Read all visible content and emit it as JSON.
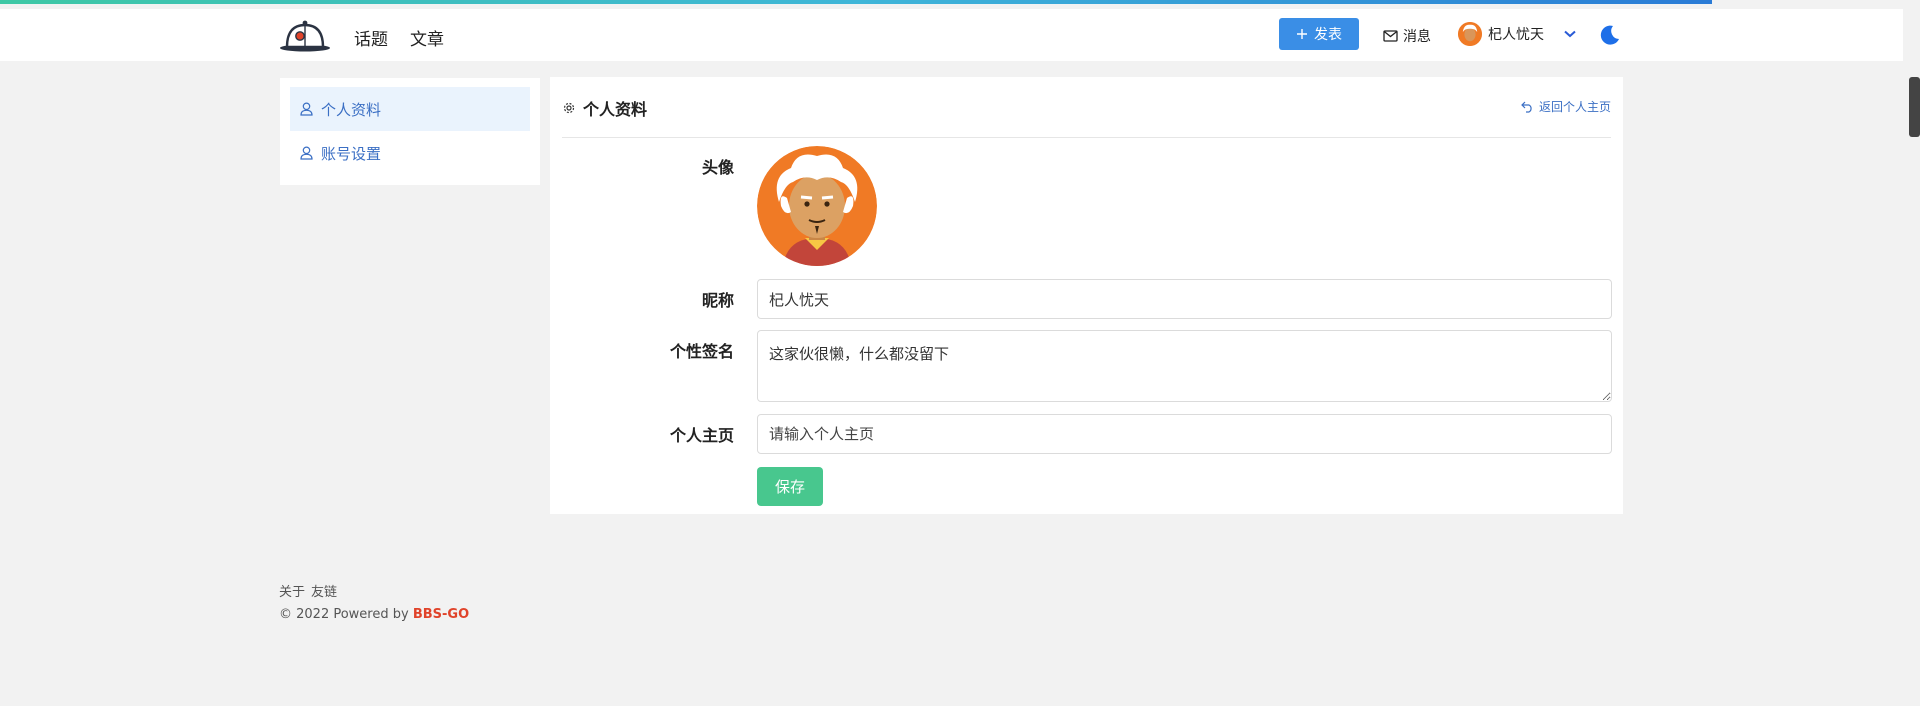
{
  "colors": {
    "accent": "#3a8ee6",
    "save": "#48c78e",
    "link": "#3b6fc4",
    "brand": "#e0432a",
    "avatar_bg": "#f07a25"
  },
  "header": {
    "nav": [
      {
        "label": "话题"
      },
      {
        "label": "文章"
      }
    ],
    "post_label": "发表",
    "post_icon": "plus-icon",
    "messages_label": "消息",
    "messages_icon": "mail-icon",
    "user_name": "杞人忧天",
    "theme_icon": "moon-icon"
  },
  "sidebar": {
    "items": [
      {
        "label": "个人资料",
        "icon": "user-icon",
        "active": true
      },
      {
        "label": "账号设置",
        "icon": "user-icon",
        "active": false
      }
    ]
  },
  "main": {
    "title": "个人资料",
    "title_icon": "gear-icon",
    "back_label": "返回个人主页",
    "back_icon": "return-icon",
    "form": {
      "avatar_label": "头像",
      "nickname_label": "昵称",
      "nickname_value": "杞人忧天",
      "signature_label": "个性签名",
      "signature_value": "这家伙很懒，什么都没留下",
      "homepage_label": "个人主页",
      "homepage_placeholder": "请输入个人主页",
      "save_label": "保存"
    }
  },
  "footer": {
    "links": [
      "关于",
      "友链"
    ],
    "copyright": "© 2022 Powered by ",
    "brand": "BBS-GO"
  }
}
